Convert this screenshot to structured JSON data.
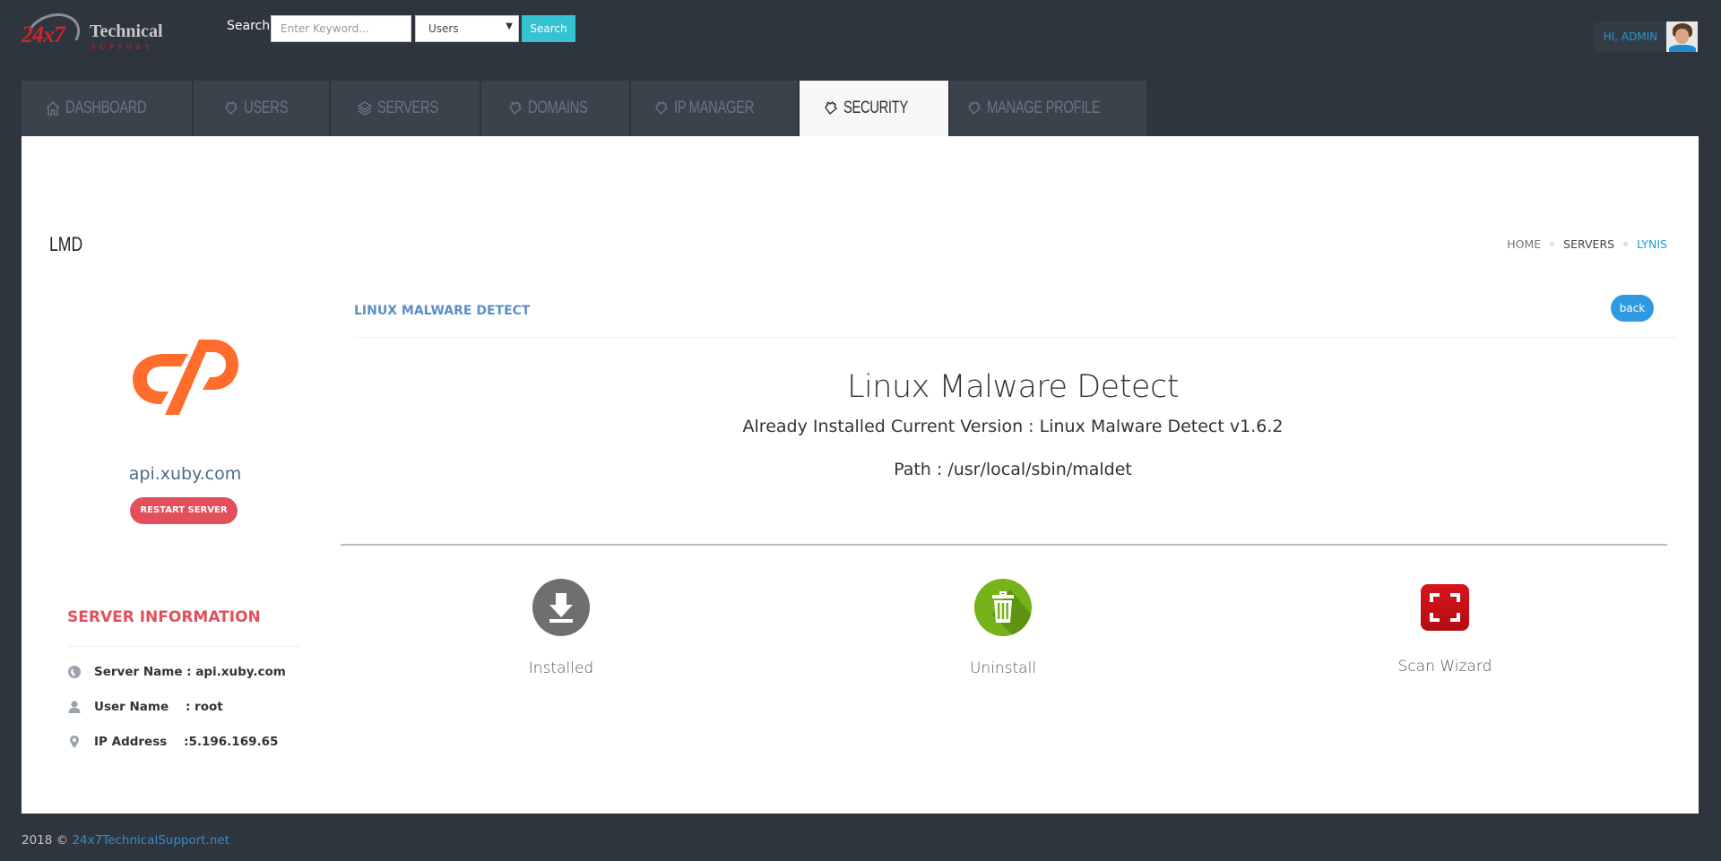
{
  "header": {
    "logo": {
      "number": "24x7",
      "word": "Technical",
      "sub": "SUPPORT"
    },
    "search": {
      "label": "Search",
      "placeholder": "Enter Keyword...",
      "value": "",
      "select_value": "Users",
      "button_label": "Search"
    },
    "user": {
      "greeting": "HI, ADMIN"
    }
  },
  "tabs": [
    {
      "label": "DASHBOARD",
      "icon": "home-icon",
      "active": false
    },
    {
      "label": "USERS",
      "icon": "puzzle-icon",
      "active": false
    },
    {
      "label": "SERVERS",
      "icon": "layers-icon",
      "active": false
    },
    {
      "label": "DOMAINS",
      "icon": "puzzle-icon",
      "active": false
    },
    {
      "label": "IP MANAGER",
      "icon": "puzzle-icon",
      "active": false
    },
    {
      "label": "SECURITY",
      "icon": "puzzle-icon",
      "active": true
    },
    {
      "label": "MANAGE PROFILE",
      "icon": "puzzle-icon",
      "active": false
    }
  ],
  "page": {
    "title": "LMD",
    "breadcrumb": [
      "HOME",
      "SERVERS",
      "LYNIS"
    ]
  },
  "server": {
    "hostname": "api.xuby.com",
    "restart_label": "RESTART SERVER",
    "info_title": "SERVER INFORMATION",
    "info": [
      {
        "icon": "globe-icon",
        "label": "Server Name",
        "text": "Server Name : api.xuby.com"
      },
      {
        "icon": "user-icon",
        "label": "User Name",
        "text": "User Name    : root"
      },
      {
        "icon": "map-pin-icon",
        "label": "IP Address",
        "text": "IP Address    :5.196.169.65"
      }
    ]
  },
  "main": {
    "section_title": "LINUX MALWARE DETECT",
    "back_label": "back",
    "title": "Linux Malware Detect",
    "version_line": "Already Installed Current Version : Linux Malware Detect v1.6.2",
    "path_line": "Path : /usr/local/sbin/maldet",
    "actions": [
      {
        "label": "Installed",
        "icon": "download-icon",
        "color": "#6f6f6f"
      },
      {
        "label": "Uninstall",
        "icon": "trash-icon",
        "color": "#76b21a"
      },
      {
        "label": "Scan Wizard",
        "icon": "scan-icon",
        "color": "#d9141c"
      }
    ]
  },
  "footer": {
    "copyright": "2018 © ",
    "link_text": "24x7TechnicalSupport.net"
  },
  "colors": {
    "background": "#2f353e",
    "tab_bg": "#3a424c",
    "accent_cyan": "#35c3d3",
    "accent_blue": "#2e9ae0",
    "danger": "#e3505b",
    "cpanel_orange": "#ff6c2c"
  }
}
